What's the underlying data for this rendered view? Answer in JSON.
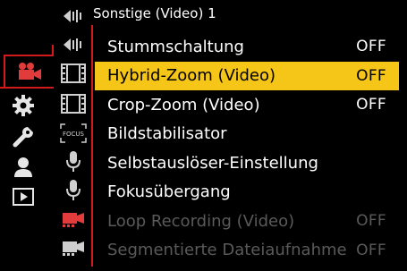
{
  "header": {
    "title": "Sonstige (Video) 1"
  },
  "menu": {
    "items": [
      {
        "label": "Stummschaltung",
        "value": "OFF",
        "state": "normal"
      },
      {
        "label": "Hybrid-Zoom (Video)",
        "value": "OFF",
        "state": "selected"
      },
      {
        "label": "Crop-Zoom (Video)",
        "value": "OFF",
        "state": "normal"
      },
      {
        "label": "Bildstabilisator",
        "value": "",
        "state": "normal"
      },
      {
        "label": "Selbstauslöser-Einstellung",
        "value": "",
        "state": "normal"
      },
      {
        "label": "Fokusübergang",
        "value": "",
        "state": "normal"
      },
      {
        "label": "Loop Recording (Video)",
        "value": "OFF",
        "state": "disabled"
      },
      {
        "label": "Segmentierte Dateiaufnahme",
        "value": "OFF",
        "state": "disabled"
      }
    ]
  },
  "main_categories": [
    {
      "icon": "video-camera-icon",
      "active": true
    },
    {
      "icon": "gear-icon",
      "active": false
    },
    {
      "icon": "wrench-icon",
      "active": false
    },
    {
      "icon": "person-icon",
      "active": false
    },
    {
      "icon": "playback-icon",
      "active": false
    }
  ],
  "sub_tabs": [
    {
      "icon": "sound-wave-icon"
    },
    {
      "icon": "sound-wave-icon"
    },
    {
      "icon": "film-strip-icon"
    },
    {
      "icon": "film-strip-icon"
    },
    {
      "icon": "focus-icon",
      "label": "FOCUS"
    },
    {
      "icon": "microphone-icon"
    },
    {
      "icon": "microphone-icon"
    },
    {
      "icon": "red-video-camera-icon"
    },
    {
      "icon": "white-video-camera-icon"
    }
  ],
  "colors": {
    "accent_red": "#d21a1a",
    "highlight_yellow": "#f5c518",
    "disabled_gray": "#5a5a5a"
  }
}
